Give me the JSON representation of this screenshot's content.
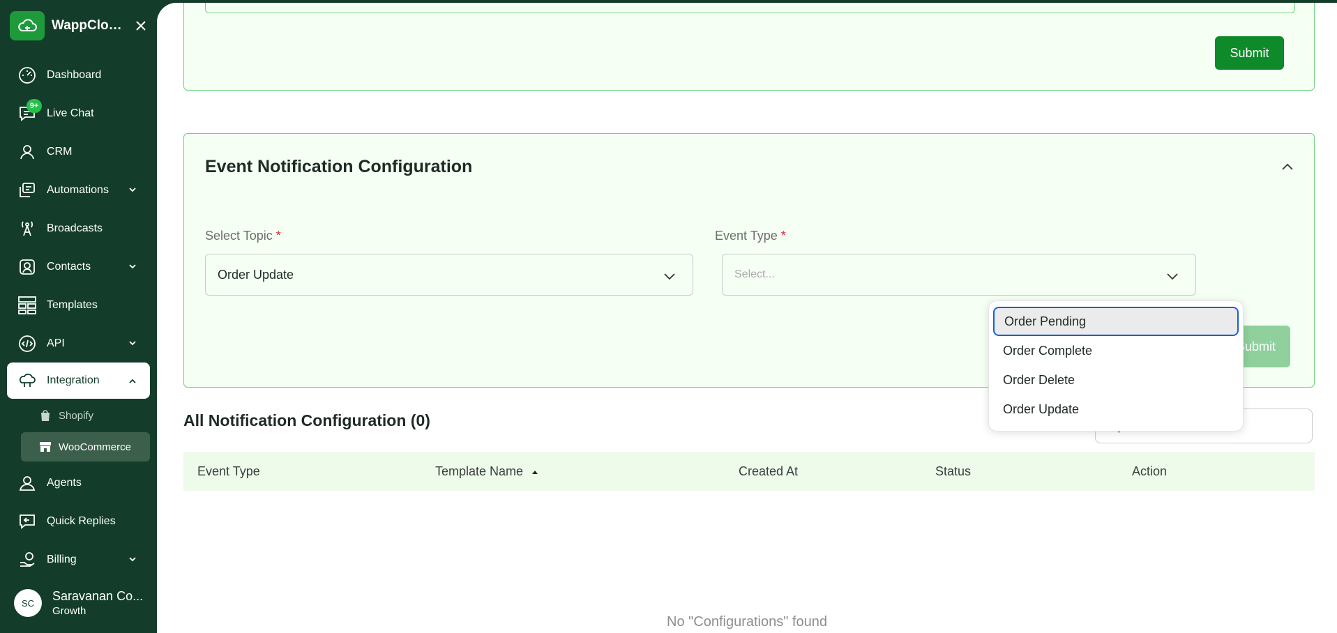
{
  "brand": {
    "name": "WappCloud..."
  },
  "nav": {
    "items": [
      {
        "label": "Dashboard"
      },
      {
        "label": "Live Chat",
        "badge": "9+"
      },
      {
        "label": "CRM"
      },
      {
        "label": "Automations"
      },
      {
        "label": "Broadcasts"
      },
      {
        "label": "Contacts"
      },
      {
        "label": "Templates"
      },
      {
        "label": "API"
      },
      {
        "label": "Integration"
      },
      {
        "label": "Agents"
      },
      {
        "label": "Quick Replies"
      },
      {
        "label": "Billing"
      }
    ],
    "sub_items": [
      {
        "label": "Shopify"
      },
      {
        "label": "WooCommerce"
      }
    ]
  },
  "user": {
    "initials": "SC",
    "name": "Saravanan Co...",
    "plan": "Growth"
  },
  "top_card": {
    "submit_label": "Submit"
  },
  "event_card": {
    "title": "Event Notification Configuration",
    "topic_label": "Select Topic",
    "topic_value": "Order Update",
    "event_type_label": "Event Type",
    "event_type_placeholder": "Select...",
    "required_mark": "*",
    "submit_label": "Submit"
  },
  "dropdown": {
    "options": [
      "Order Pending",
      "Order Complete",
      "Order Delete",
      "Order Update"
    ]
  },
  "list_section": {
    "title": "All Notification Configuration (0)",
    "search_placeholder": "Search...",
    "columns": [
      "Event Type",
      "Template Name",
      "Created At",
      "Status",
      "Action"
    ],
    "empty_text": "No \"Configurations\" found"
  },
  "colors": {
    "sidebar": "#133d2a",
    "accent": "#0e8a2a",
    "card_border": "#6fd17d",
    "badge": "#25c04a"
  }
}
